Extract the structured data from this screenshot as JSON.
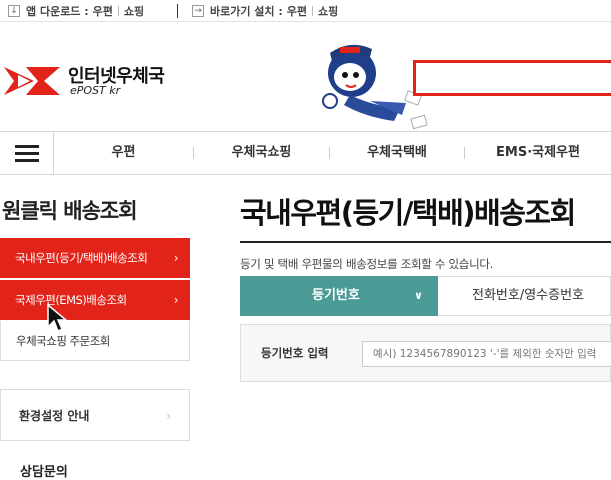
{
  "topbar": {
    "app_download_label": "앱 다운로드 :",
    "app_links": [
      "우편",
      "쇼핑"
    ],
    "shortcut_label": "바로가기 설치 :",
    "shortcut_links": [
      "우편",
      "쇼핑"
    ]
  },
  "header": {
    "logo_title": "인터넷우체국",
    "logo_sub": "ePOST kr"
  },
  "gnb": {
    "items": [
      "우편",
      "우체국쇼핑",
      "우체국택배",
      "EMS·국제우편"
    ]
  },
  "sidebar": {
    "title": "원클릭 배송조회",
    "items": [
      {
        "label": "국내우편(등기/택배)배송조회",
        "arrow": "›"
      },
      {
        "label": "국제우편(EMS)배송조회",
        "arrow": "›"
      },
      {
        "label": "우체국쇼핑 주문조회"
      }
    ],
    "env_label": "환경설정 안내",
    "env_arrow": "›",
    "consult_label": "상담문의"
  },
  "main": {
    "title": "국내우편(등기/택배)배송조회",
    "description": "등기 및 택배 우편물의 배송정보를 조회할 수 있습니다.",
    "tab_active_label": "등기번호",
    "tab_active_chevron": "∨",
    "tab_other_label": "전화번호/영수증번호",
    "input_label": "등기번호 입력",
    "input_placeholder": "예시) 1234567890123 '-'를 제외한 숫자만 입력"
  },
  "colors": {
    "brand_red": "#e2231a",
    "tab_teal": "#4a9a96"
  }
}
